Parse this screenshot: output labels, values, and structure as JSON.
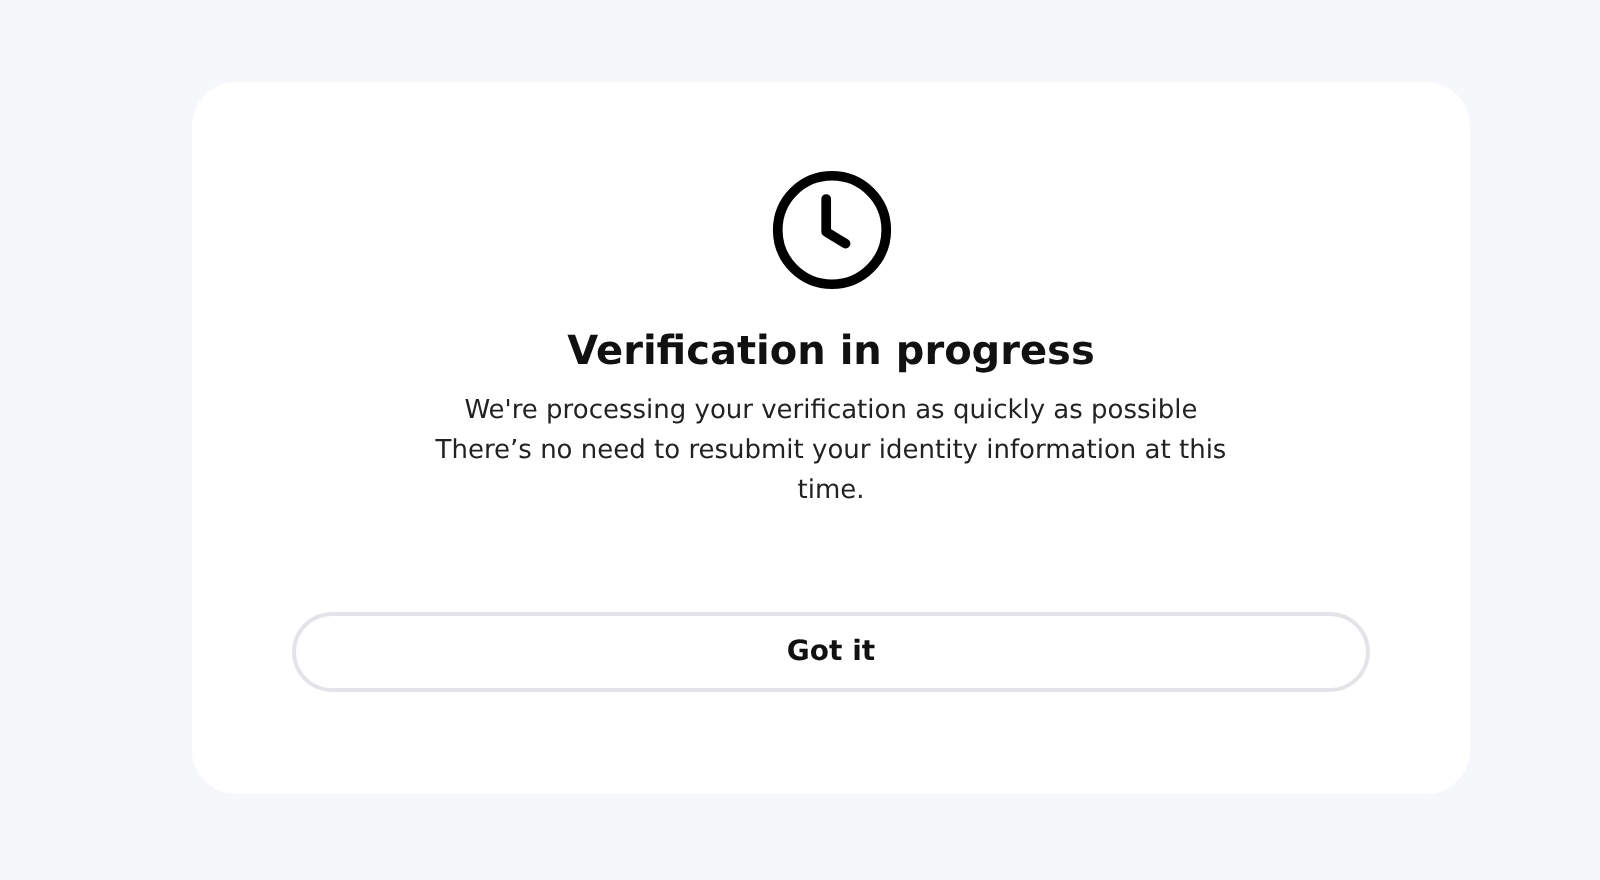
{
  "dialog": {
    "title": "Verification in progress",
    "message": [
      "We're processing your verification as quickly as possible",
      "There’s no need to resubmit your identity information at this time."
    ],
    "button": "Got it"
  }
}
